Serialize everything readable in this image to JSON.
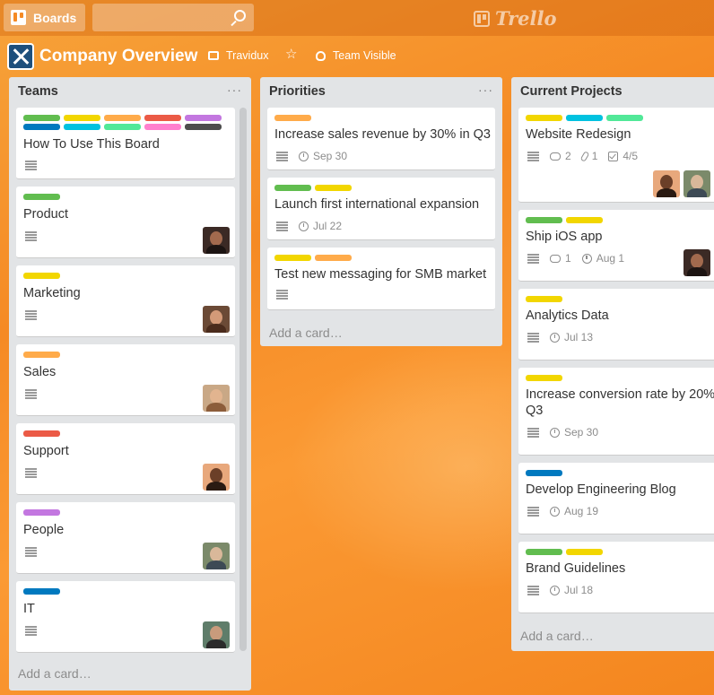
{
  "header": {
    "boards_label": "Boards",
    "logo_text": "Trello",
    "search_placeholder": ""
  },
  "board": {
    "title": "Company Overview",
    "org": "Travidux",
    "visibility": "Team Visible"
  },
  "colors": {
    "green": "#61bd4f",
    "yellow": "#f2d600",
    "orange": "#ffab4a",
    "red": "#eb5a46",
    "purple": "#c377e0",
    "blue": "#0079bf",
    "sky": "#00c2e0",
    "lime": "#51e898",
    "pink": "#ff80ce",
    "black": "#4d4d4d"
  },
  "lists": [
    {
      "title": "Teams",
      "add_card": "Add a card…",
      "cards": [
        {
          "title": "How To Use This Board",
          "labels": [
            "green",
            "yellow",
            "orange",
            "red",
            "purple",
            "blue",
            "sky",
            "lime",
            "pink",
            "black"
          ]
        },
        {
          "title": "Product",
          "labels": [
            "green"
          ]
        },
        {
          "title": "Marketing",
          "labels": [
            "yellow"
          ]
        },
        {
          "title": "Sales",
          "labels": [
            "orange"
          ]
        },
        {
          "title": "Support",
          "labels": [
            "red"
          ]
        },
        {
          "title": "People",
          "labels": [
            "purple"
          ]
        },
        {
          "title": "IT",
          "labels": [
            "blue"
          ]
        }
      ]
    },
    {
      "title": "Priorities",
      "add_card": "Add a card…",
      "cards": [
        {
          "title": "Increase sales revenue by 30% in Q3",
          "labels": [
            "orange"
          ],
          "due": "Sep 30"
        },
        {
          "title": "Launch first international expansion",
          "labels": [
            "green",
            "yellow"
          ],
          "due": "Jul 22"
        },
        {
          "title": "Test new messaging for SMB market",
          "labels": [
            "yellow",
            "orange"
          ]
        }
      ]
    },
    {
      "title": "Current Projects",
      "add_card": "Add a card…",
      "cards": [
        {
          "title": "Website Redesign",
          "labels": [
            "yellow",
            "sky",
            "lime"
          ],
          "comments": "2",
          "attachments": "1",
          "checklist": "4/5"
        },
        {
          "title": "Ship iOS app",
          "labels": [
            "green",
            "yellow"
          ],
          "comments": "1",
          "due": "Aug 1"
        },
        {
          "title": "Analytics Data",
          "labels": [
            "yellow"
          ],
          "due": "Jul 13"
        },
        {
          "title": "Increase conversion rate by 20% Q3",
          "labels": [
            "yellow"
          ],
          "due": "Sep 30"
        },
        {
          "title": "Develop Engineering Blog",
          "labels": [
            "blue"
          ],
          "due": "Aug 19"
        },
        {
          "title": "Brand Guidelines",
          "labels": [
            "green",
            "yellow"
          ],
          "due": "Jul 18"
        }
      ]
    }
  ]
}
